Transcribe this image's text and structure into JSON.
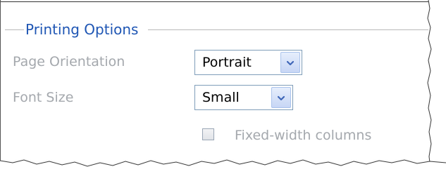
{
  "fieldset": {
    "legend": "Printing Options"
  },
  "fields": {
    "page_orientation": {
      "label": "Page Orientation",
      "value": "Portrait"
    },
    "font_size": {
      "label": "Font Size",
      "value": "Small"
    }
  },
  "options": {
    "fixed_width_columns": {
      "label": "Fixed-width columns",
      "checked": false
    }
  },
  "colors": {
    "legend": "#1f56b4",
    "label": "#a4a8ad",
    "select_border": "#7f9db9",
    "chevron": "#3f67b8"
  },
  "icons": {
    "dropdown": "chevron-down-icon"
  }
}
